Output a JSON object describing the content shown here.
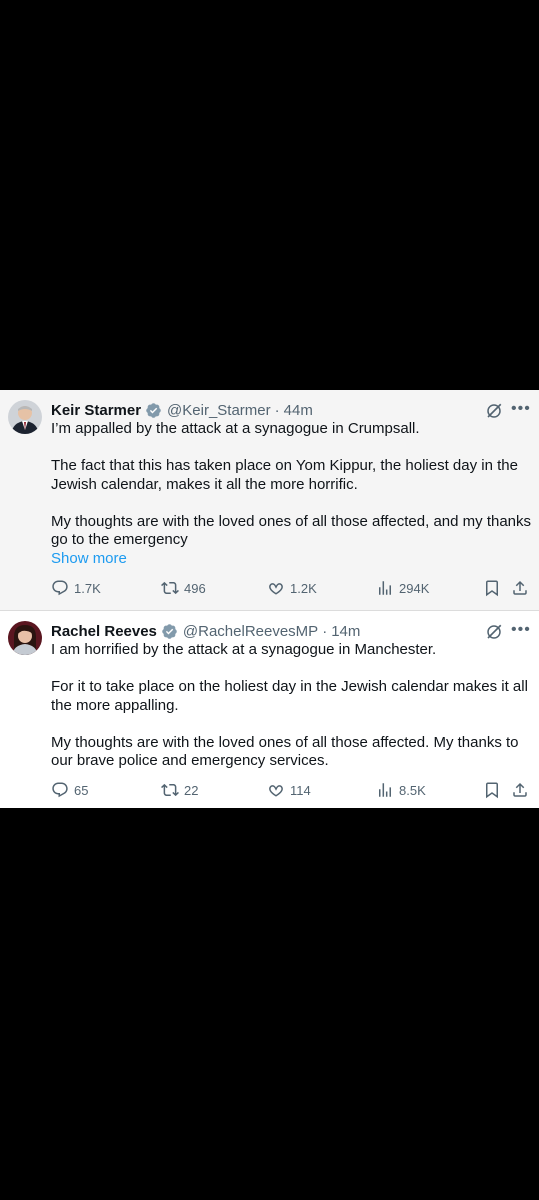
{
  "tweets": [
    {
      "name": "Keir Starmer",
      "handle": "@Keir_Starmer",
      "dot": "·",
      "time": "44m",
      "paragraphs": [
        "I’m appalled by the attack at a synagogue in Crumpsall.",
        "The fact that this has taken place on Yom Kippur, the holiest day in the Jewish calendar, makes it all the more horrific.",
        "My thoughts are with the loved ones of all those affected, and my thanks go to the emergency"
      ],
      "show_more": "Show more",
      "replies": "1.7K",
      "reposts": "496",
      "likes": "1.2K",
      "views": "294K"
    },
    {
      "name": "Rachel Reeves",
      "handle": "@RachelReevesMP",
      "dot": "·",
      "time": "14m",
      "paragraphs": [
        "I am horrified by the attack at a synagogue in Manchester.",
        "For it to take place on the holiest day in the Jewish calendar makes it all the more appalling.",
        "My thoughts are with the loved ones of all those affected. My thanks to our brave police and emergency services."
      ],
      "replies": "65",
      "reposts": "22",
      "likes": "114",
      "views": "8.5K"
    }
  ],
  "colors": {
    "text": "#0f1419",
    "secondary": "#536471",
    "link": "#1d9bf0",
    "verified": "#829aab"
  }
}
